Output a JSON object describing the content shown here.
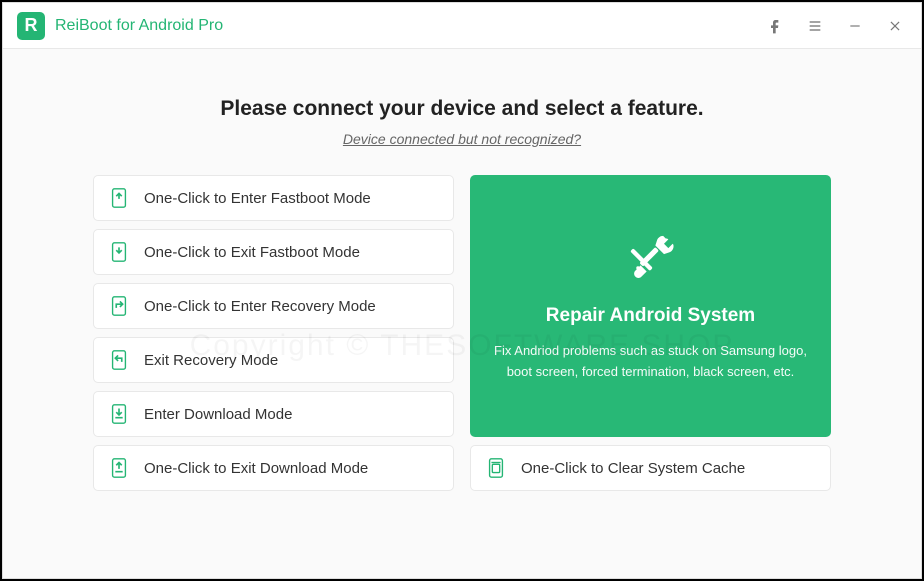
{
  "app": {
    "title": "ReiBoot for Android Pro",
    "logo_letter": "R"
  },
  "main": {
    "heading": "Please connect your device and select a feature.",
    "sublink": "Device connected but not recognized?"
  },
  "options": {
    "enter_fastboot": "One-Click to Enter Fastboot Mode",
    "exit_fastboot": "One-Click to Exit Fastboot Mode",
    "enter_recovery": "One-Click to Enter Recovery Mode",
    "exit_recovery": "Exit Recovery Mode",
    "enter_download": "Enter Download Mode",
    "exit_download": "One-Click to Exit Download Mode",
    "clear_cache": "One-Click to Clear System Cache"
  },
  "repair": {
    "title": "Repair Android System",
    "description": "Fix Andriod problems such as stuck on Samsung logo, boot screen, forced termination, black screen, etc."
  },
  "watermark": "Copyright © THESOFTWARE.SHOP"
}
